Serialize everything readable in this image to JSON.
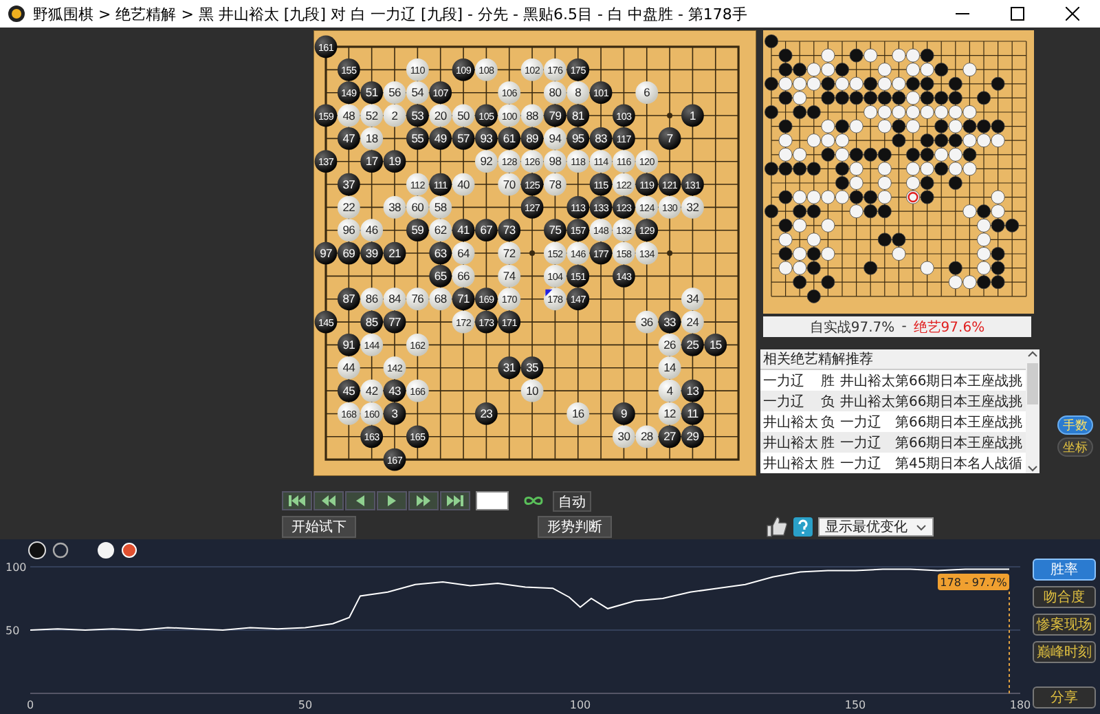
{
  "window": {
    "title": "野狐围棋 > 绝艺精解 > 黑 井山裕太 [九段] 对 白 一力辽 [九段] - 分先 - 黑贴6.5目 - 白 中盘胜 - 第178手"
  },
  "board": {
    "rows": [
      [
        {
          "label": "161",
          "kind": "black",
          "marked": false
        },
        {
          "kind": "empty"
        },
        {
          "kind": "empty"
        },
        {
          "kind": "empty"
        },
        {
          "kind": "empty"
        },
        {
          "kind": "empty"
        },
        {
          "kind": "empty"
        },
        {
          "kind": "empty"
        },
        {
          "kind": "empty"
        },
        {
          "kind": "empty"
        },
        {
          "kind": "empty"
        },
        {
          "kind": "empty"
        },
        {
          "kind": "empty"
        },
        {
          "kind": "empty"
        },
        {
          "kind": "empty"
        },
        {
          "kind": "empty"
        },
        {
          "kind": "empty"
        },
        {
          "kind": "empty"
        },
        {
          "kind": "empty"
        }
      ],
      [
        {
          "kind": "empty"
        },
        {
          "label": "155",
          "kind": "black",
          "marked": false
        },
        {
          "kind": "empty"
        },
        {
          "kind": "empty"
        },
        {
          "label": "110",
          "kind": "white",
          "marked": false
        },
        {
          "kind": "empty"
        },
        {
          "label": "109",
          "kind": "black",
          "marked": false
        },
        {
          "label": "108",
          "kind": "white",
          "marked": false
        },
        {
          "kind": "empty"
        },
        {
          "label": "102",
          "kind": "white",
          "marked": false
        },
        {
          "label": "176",
          "kind": "white",
          "marked": false
        },
        {
          "label": "175",
          "kind": "black",
          "marked": false
        },
        {
          "kind": "empty"
        },
        {
          "kind": "empty"
        },
        {
          "kind": "empty"
        },
        {
          "kind": "empty"
        },
        {
          "kind": "empty"
        },
        {
          "kind": "empty"
        },
        {
          "kind": "empty"
        }
      ],
      [
        {
          "kind": "empty"
        },
        {
          "label": "149",
          "kind": "black",
          "marked": false
        },
        {
          "label": "51",
          "kind": "black",
          "marked": false
        },
        {
          "label": "56",
          "kind": "white",
          "marked": false
        },
        {
          "label": "54",
          "kind": "white",
          "marked": false
        },
        {
          "label": "107",
          "kind": "black",
          "marked": false
        },
        {
          "kind": "empty"
        },
        {
          "kind": "empty"
        },
        {
          "label": "106",
          "kind": "white",
          "marked": false
        },
        {
          "kind": "empty"
        },
        {
          "label": "80",
          "kind": "white",
          "marked": false
        },
        {
          "label": "8",
          "kind": "white",
          "marked": false
        },
        {
          "label": "101",
          "kind": "black",
          "marked": false
        },
        {
          "kind": "empty"
        },
        {
          "label": "6",
          "kind": "white",
          "marked": false
        },
        {
          "kind": "empty"
        },
        {
          "kind": "empty"
        },
        {
          "kind": "empty"
        },
        {
          "kind": "empty"
        }
      ],
      [
        {
          "label": "159",
          "kind": "black",
          "marked": false
        },
        {
          "label": "48",
          "kind": "white",
          "marked": false
        },
        {
          "label": "52",
          "kind": "white",
          "marked": false
        },
        {
          "label": "2",
          "kind": "white",
          "marked": false
        },
        {
          "label": "53",
          "kind": "black",
          "marked": false
        },
        {
          "label": "20",
          "kind": "white",
          "marked": false
        },
        {
          "label": "50",
          "kind": "white",
          "marked": false
        },
        {
          "label": "105",
          "kind": "black",
          "marked": false
        },
        {
          "label": "100",
          "kind": "white",
          "marked": false
        },
        {
          "label": "88",
          "kind": "white",
          "marked": false
        },
        {
          "label": "79",
          "kind": "black",
          "marked": false
        },
        {
          "label": "81",
          "kind": "black",
          "marked": false
        },
        {
          "kind": "empty"
        },
        {
          "label": "103",
          "kind": "black",
          "marked": false
        },
        {
          "kind": "empty"
        },
        {
          "kind": "empty"
        },
        {
          "label": "1",
          "kind": "black",
          "marked": false
        },
        {
          "kind": "empty"
        },
        {
          "kind": "empty"
        }
      ],
      [
        {
          "kind": "empty"
        },
        {
          "label": "47",
          "kind": "black",
          "marked": false
        },
        {
          "label": "18",
          "kind": "white",
          "marked": false
        },
        {
          "kind": "empty"
        },
        {
          "label": "55",
          "kind": "black",
          "marked": false
        },
        {
          "label": "49",
          "kind": "black",
          "marked": false
        },
        {
          "label": "57",
          "kind": "black",
          "marked": false
        },
        {
          "label": "93",
          "kind": "black",
          "marked": false
        },
        {
          "label": "61",
          "kind": "black",
          "marked": false
        },
        {
          "label": "89",
          "kind": "black",
          "marked": false
        },
        {
          "label": "94",
          "kind": "white",
          "marked": false
        },
        {
          "label": "95",
          "kind": "black",
          "marked": false
        },
        {
          "label": "83",
          "kind": "black",
          "marked": false
        },
        {
          "label": "117",
          "kind": "black",
          "marked": false
        },
        {
          "kind": "empty"
        },
        {
          "label": "7",
          "kind": "black",
          "marked": false
        },
        {
          "kind": "empty"
        },
        {
          "kind": "empty"
        },
        {
          "kind": "empty"
        }
      ],
      [
        {
          "label": "137",
          "kind": "black",
          "marked": false
        },
        {
          "kind": "empty"
        },
        {
          "label": "17",
          "kind": "black",
          "marked": false
        },
        {
          "label": "19",
          "kind": "black",
          "marked": false
        },
        {
          "kind": "empty"
        },
        {
          "kind": "empty"
        },
        {
          "kind": "empty"
        },
        {
          "label": "92",
          "kind": "white",
          "marked": false
        },
        {
          "label": "128",
          "kind": "white",
          "marked": false
        },
        {
          "label": "126",
          "kind": "white",
          "marked": false
        },
        {
          "label": "98",
          "kind": "white",
          "marked": false
        },
        {
          "label": "118",
          "kind": "white",
          "marked": false
        },
        {
          "label": "114",
          "kind": "white",
          "marked": false
        },
        {
          "label": "116",
          "kind": "white",
          "marked": false
        },
        {
          "label": "120",
          "kind": "white",
          "marked": false
        },
        {
          "kind": "empty"
        },
        {
          "kind": "empty"
        },
        {
          "kind": "empty"
        },
        {
          "kind": "empty"
        }
      ],
      [
        {
          "kind": "empty"
        },
        {
          "label": "37",
          "kind": "black",
          "marked": false
        },
        {
          "kind": "empty"
        },
        {
          "kind": "empty"
        },
        {
          "label": "112",
          "kind": "white",
          "marked": false
        },
        {
          "label": "111",
          "kind": "black",
          "marked": false
        },
        {
          "label": "40",
          "kind": "white",
          "marked": false
        },
        {
          "kind": "empty"
        },
        {
          "label": "70",
          "kind": "white",
          "marked": false
        },
        {
          "label": "125",
          "kind": "black",
          "marked": false
        },
        {
          "label": "78",
          "kind": "white",
          "marked": false
        },
        {
          "kind": "empty"
        },
        {
          "label": "115",
          "kind": "black",
          "marked": false
        },
        {
          "label": "122",
          "kind": "white",
          "marked": false
        },
        {
          "label": "119",
          "kind": "black",
          "marked": false
        },
        {
          "label": "121",
          "kind": "black",
          "marked": false
        },
        {
          "label": "131",
          "kind": "black",
          "marked": false
        },
        {
          "kind": "empty"
        },
        {
          "kind": "empty"
        }
      ],
      [
        {
          "kind": "empty"
        },
        {
          "label": "22",
          "kind": "white",
          "marked": false
        },
        {
          "kind": "empty"
        },
        {
          "label": "38",
          "kind": "white",
          "marked": false
        },
        {
          "label": "60",
          "kind": "white",
          "marked": false
        },
        {
          "label": "58",
          "kind": "white",
          "marked": false
        },
        {
          "kind": "empty"
        },
        {
          "kind": "empty"
        },
        {
          "kind": "empty"
        },
        {
          "label": "127",
          "kind": "black",
          "marked": false
        },
        {
          "kind": "empty"
        },
        {
          "label": "113",
          "kind": "black",
          "marked": false
        },
        {
          "label": "133",
          "kind": "black",
          "marked": false
        },
        {
          "label": "123",
          "kind": "black",
          "marked": false
        },
        {
          "label": "124",
          "kind": "white",
          "marked": false
        },
        {
          "label": "130",
          "kind": "white",
          "marked": false
        },
        {
          "label": "32",
          "kind": "white",
          "marked": false
        },
        {
          "kind": "empty"
        },
        {
          "kind": "empty"
        }
      ],
      [
        {
          "kind": "empty"
        },
        {
          "label": "96",
          "kind": "white",
          "marked": false
        },
        {
          "label": "46",
          "kind": "white",
          "marked": false
        },
        {
          "kind": "empty"
        },
        {
          "label": "59",
          "kind": "black",
          "marked": false
        },
        {
          "label": "62",
          "kind": "white",
          "marked": false
        },
        {
          "label": "41",
          "kind": "black",
          "marked": false
        },
        {
          "label": "67",
          "kind": "black",
          "marked": false
        },
        {
          "label": "73",
          "kind": "black",
          "marked": false
        },
        {
          "kind": "empty"
        },
        {
          "label": "75",
          "kind": "black",
          "marked": false
        },
        {
          "label": "157",
          "kind": "black",
          "marked": false
        },
        {
          "label": "148",
          "kind": "white",
          "marked": false
        },
        {
          "label": "132",
          "kind": "white",
          "marked": false
        },
        {
          "label": "129",
          "kind": "black",
          "marked": false
        },
        {
          "kind": "empty"
        },
        {
          "kind": "empty"
        },
        {
          "kind": "empty"
        },
        {
          "kind": "empty"
        }
      ],
      [
        {
          "label": "97",
          "kind": "black",
          "marked": false
        },
        {
          "label": "69",
          "kind": "black",
          "marked": false
        },
        {
          "label": "39",
          "kind": "black",
          "marked": false
        },
        {
          "label": "21",
          "kind": "black",
          "marked": false
        },
        {
          "kind": "empty"
        },
        {
          "label": "63",
          "kind": "black",
          "marked": false
        },
        {
          "label": "64",
          "kind": "white",
          "marked": false
        },
        {
          "kind": "empty"
        },
        {
          "label": "72",
          "kind": "white",
          "marked": false
        },
        {
          "kind": "empty"
        },
        {
          "label": "152",
          "kind": "white",
          "marked": false
        },
        {
          "label": "146",
          "kind": "white",
          "marked": false
        },
        {
          "label": "177",
          "kind": "black",
          "marked": false
        },
        {
          "label": "158",
          "kind": "white",
          "marked": false
        },
        {
          "label": "134",
          "kind": "white",
          "marked": false
        },
        {
          "kind": "empty"
        },
        {
          "kind": "empty"
        },
        {
          "kind": "empty"
        },
        {
          "kind": "empty"
        }
      ],
      [
        {
          "kind": "empty"
        },
        {
          "kind": "empty"
        },
        {
          "kind": "empty"
        },
        {
          "kind": "empty"
        },
        {
          "kind": "empty"
        },
        {
          "label": "65",
          "kind": "black",
          "marked": false
        },
        {
          "label": "66",
          "kind": "white",
          "marked": false
        },
        {
          "kind": "empty"
        },
        {
          "label": "74",
          "kind": "white",
          "marked": false
        },
        {
          "kind": "empty"
        },
        {
          "label": "104",
          "kind": "white",
          "marked": false
        },
        {
          "label": "151",
          "kind": "black",
          "marked": false
        },
        {
          "kind": "empty"
        },
        {
          "label": "143",
          "kind": "black",
          "marked": false
        },
        {
          "kind": "empty"
        },
        {
          "kind": "empty"
        },
        {
          "kind": "empty"
        },
        {
          "kind": "empty"
        },
        {
          "kind": "empty"
        }
      ],
      [
        {
          "kind": "empty"
        },
        {
          "label": "87",
          "kind": "black",
          "marked": false
        },
        {
          "label": "86",
          "kind": "white",
          "marked": false
        },
        {
          "label": "84",
          "kind": "white",
          "marked": false
        },
        {
          "label": "76",
          "kind": "white",
          "marked": false
        },
        {
          "label": "68",
          "kind": "white",
          "marked": false
        },
        {
          "label": "71",
          "kind": "black",
          "marked": false
        },
        {
          "label": "169",
          "kind": "black",
          "marked": false
        },
        {
          "label": "170",
          "kind": "white",
          "marked": false
        },
        {
          "kind": "empty"
        },
        {
          "label": "178",
          "kind": "white",
          "marked": true
        },
        {
          "label": "147",
          "kind": "black",
          "marked": false
        },
        {
          "kind": "empty"
        },
        {
          "kind": "empty"
        },
        {
          "kind": "empty"
        },
        {
          "kind": "empty"
        },
        {
          "label": "34",
          "kind": "white",
          "marked": false
        },
        {
          "kind": "empty"
        },
        {
          "kind": "empty"
        }
      ],
      [
        {
          "label": "145",
          "kind": "black",
          "marked": false
        },
        {
          "kind": "empty"
        },
        {
          "label": "85",
          "kind": "black",
          "marked": false
        },
        {
          "label": "77",
          "kind": "black",
          "marked": false
        },
        {
          "kind": "empty"
        },
        {
          "kind": "empty"
        },
        {
          "label": "172",
          "kind": "white",
          "marked": false
        },
        {
          "label": "173",
          "kind": "black",
          "marked": false
        },
        {
          "label": "171",
          "kind": "black",
          "marked": false
        },
        {
          "kind": "empty"
        },
        {
          "kind": "empty"
        },
        {
          "kind": "empty"
        },
        {
          "kind": "empty"
        },
        {
          "kind": "empty"
        },
        {
          "label": "36",
          "kind": "white",
          "marked": false
        },
        {
          "label": "33",
          "kind": "black",
          "marked": false
        },
        {
          "label": "24",
          "kind": "white",
          "marked": false
        },
        {
          "kind": "empty"
        },
        {
          "kind": "empty"
        }
      ],
      [
        {
          "kind": "empty"
        },
        {
          "label": "91",
          "kind": "black",
          "marked": false
        },
        {
          "label": "144",
          "kind": "white",
          "marked": false
        },
        {
          "kind": "empty"
        },
        {
          "label": "162",
          "kind": "white",
          "marked": false
        },
        {
          "kind": "empty"
        },
        {
          "kind": "empty"
        },
        {
          "kind": "empty"
        },
        {
          "kind": "empty"
        },
        {
          "kind": "empty"
        },
        {
          "kind": "empty"
        },
        {
          "kind": "empty"
        },
        {
          "kind": "empty"
        },
        {
          "kind": "empty"
        },
        {
          "kind": "empty"
        },
        {
          "label": "26",
          "kind": "white",
          "marked": false
        },
        {
          "label": "25",
          "kind": "black",
          "marked": false
        },
        {
          "label": "15",
          "kind": "black",
          "marked": false
        },
        {
          "kind": "empty"
        }
      ],
      [
        {
          "kind": "empty"
        },
        {
          "label": "44",
          "kind": "white",
          "marked": false
        },
        {
          "kind": "empty"
        },
        {
          "label": "142",
          "kind": "white",
          "marked": false
        },
        {
          "kind": "empty"
        },
        {
          "kind": "empty"
        },
        {
          "kind": "empty"
        },
        {
          "kind": "empty"
        },
        {
          "label": "31",
          "kind": "black",
          "marked": false
        },
        {
          "label": "35",
          "kind": "black",
          "marked": false
        },
        {
          "kind": "empty"
        },
        {
          "kind": "empty"
        },
        {
          "kind": "empty"
        },
        {
          "kind": "empty"
        },
        {
          "kind": "empty"
        },
        {
          "label": "14",
          "kind": "white",
          "marked": false
        },
        {
          "kind": "empty"
        },
        {
          "kind": "empty"
        },
        {
          "kind": "empty"
        }
      ],
      [
        {
          "kind": "empty"
        },
        {
          "label": "45",
          "kind": "black",
          "marked": false
        },
        {
          "label": "42",
          "kind": "white",
          "marked": false
        },
        {
          "label": "43",
          "kind": "black",
          "marked": false
        },
        {
          "label": "166",
          "kind": "white",
          "marked": false
        },
        {
          "kind": "empty"
        },
        {
          "kind": "empty"
        },
        {
          "kind": "empty"
        },
        {
          "kind": "empty"
        },
        {
          "label": "10",
          "kind": "white",
          "marked": false
        },
        {
          "kind": "empty"
        },
        {
          "kind": "empty"
        },
        {
          "kind": "empty"
        },
        {
          "kind": "empty"
        },
        {
          "kind": "empty"
        },
        {
          "label": "4",
          "kind": "white",
          "marked": false
        },
        {
          "label": "13",
          "kind": "black",
          "marked": false
        },
        {
          "kind": "empty"
        },
        {
          "kind": "empty"
        }
      ],
      [
        {
          "kind": "empty"
        },
        {
          "label": "168",
          "kind": "white",
          "marked": false
        },
        {
          "label": "160",
          "kind": "white",
          "marked": false
        },
        {
          "label": "3",
          "kind": "black",
          "marked": false
        },
        {
          "kind": "empty"
        },
        {
          "kind": "empty"
        },
        {
          "kind": "empty"
        },
        {
          "label": "23",
          "kind": "black",
          "marked": false
        },
        {
          "kind": "empty"
        },
        {
          "kind": "empty"
        },
        {
          "kind": "empty"
        },
        {
          "label": "16",
          "kind": "white",
          "marked": false
        },
        {
          "kind": "empty"
        },
        {
          "label": "9",
          "kind": "black",
          "marked": false
        },
        {
          "kind": "empty"
        },
        {
          "label": "12",
          "kind": "white",
          "marked": false
        },
        {
          "label": "11",
          "kind": "black",
          "marked": false
        },
        {
          "kind": "empty"
        },
        {
          "kind": "empty"
        }
      ],
      [
        {
          "kind": "empty"
        },
        {
          "kind": "empty"
        },
        {
          "label": "163",
          "kind": "black",
          "marked": false
        },
        {
          "kind": "empty"
        },
        {
          "label": "165",
          "kind": "black",
          "marked": false
        },
        {
          "kind": "empty"
        },
        {
          "kind": "empty"
        },
        {
          "kind": "empty"
        },
        {
          "kind": "empty"
        },
        {
          "kind": "empty"
        },
        {
          "kind": "empty"
        },
        {
          "kind": "empty"
        },
        {
          "kind": "empty"
        },
        {
          "label": "30",
          "kind": "white",
          "marked": false
        },
        {
          "label": "28",
          "kind": "white",
          "marked": false
        },
        {
          "label": "27",
          "kind": "black",
          "marked": false
        },
        {
          "label": "29",
          "kind": "black",
          "marked": false
        },
        {
          "kind": "empty"
        },
        {
          "kind": "empty"
        }
      ],
      [
        {
          "kind": "empty"
        },
        {
          "kind": "empty"
        },
        {
          "kind": "empty"
        },
        {
          "label": "167",
          "kind": "black",
          "marked": false
        },
        {
          "kind": "empty"
        },
        {
          "kind": "empty"
        },
        {
          "kind": "empty"
        },
        {
          "kind": "empty"
        },
        {
          "kind": "empty"
        },
        {
          "kind": "empty"
        },
        {
          "kind": "empty"
        },
        {
          "kind": "empty"
        },
        {
          "kind": "empty"
        },
        {
          "kind": "empty"
        },
        {
          "kind": "empty"
        },
        {
          "kind": "empty"
        },
        {
          "kind": "empty"
        },
        {
          "kind": "empty"
        },
        {
          "kind": "empty"
        }
      ]
    ]
  },
  "comparison": {
    "actual": "自实战97.7%",
    "separator": "-",
    "ai": "绝艺97.6%"
  },
  "recommendations": {
    "title": "相关绝艺精解推荐",
    "rows": [
      {
        "player": "一力辽",
        "result": "胜",
        "opponent": "井山裕太",
        "event": "第66期日本王座战挑"
      },
      {
        "player": "一力辽",
        "result": "负",
        "opponent": "井山裕太",
        "event": "第66期日本王座战挑"
      },
      {
        "player": "井山裕太",
        "result": "负",
        "opponent": "一力辽",
        "event": "第66期日本王座战挑"
      },
      {
        "player": "井山裕太",
        "result": "胜",
        "opponent": "一力辽",
        "event": "第66期日本王座战挑"
      },
      {
        "player": "井山裕太",
        "result": "胜",
        "opponent": "一力辽",
        "event": "第45期日本名人战循"
      }
    ]
  },
  "display_toggles": [
    {
      "label": "手数",
      "selected": true
    },
    {
      "label": "坐标",
      "selected": false
    }
  ],
  "playback": {
    "auto_label": "自动"
  },
  "actions": {
    "try_label": "开始试下",
    "judge_label": "形势判断",
    "variation_select": "显示最优变化"
  },
  "winrate": {
    "tabs": [
      {
        "label": "胜率",
        "selected": true
      },
      {
        "label": "吻合度",
        "selected": false
      },
      {
        "label": "惨案现场",
        "selected": false
      },
      {
        "label": "巅峰时刻",
        "selected": false
      }
    ],
    "share_label": "分享",
    "chart_data": {
      "type": "line",
      "xlim": [
        0,
        180
      ],
      "ylim": [
        0,
        100
      ],
      "xticks": [
        0,
        50,
        100,
        150,
        180
      ],
      "yticks": [
        50,
        100
      ],
      "x": [
        0,
        5,
        10,
        15,
        20,
        25,
        30,
        35,
        40,
        45,
        50,
        55,
        58,
        60,
        65,
        70,
        75,
        80,
        85,
        90,
        95,
        98,
        100,
        102,
        105,
        110,
        115,
        120,
        125,
        130,
        135,
        140,
        145,
        150,
        155,
        160,
        165,
        170,
        175,
        178
      ],
      "series": [
        {
          "color": "#ffffff",
          "values": [
            50,
            51,
            50,
            51,
            50,
            52,
            51,
            50,
            52,
            51,
            52,
            55,
            60,
            77,
            80,
            86,
            88,
            85,
            87,
            84,
            83,
            76,
            68,
            75,
            67,
            73,
            75,
            80,
            83,
            86,
            92,
            96,
            97,
            97,
            98,
            98,
            97,
            98,
            98,
            98
          ]
        }
      ],
      "ref_lines": [
        {
          "axis": "x",
          "value": 178
        }
      ],
      "annotations": [
        {
          "text": "178 - 97.7%"
        }
      ]
    }
  }
}
